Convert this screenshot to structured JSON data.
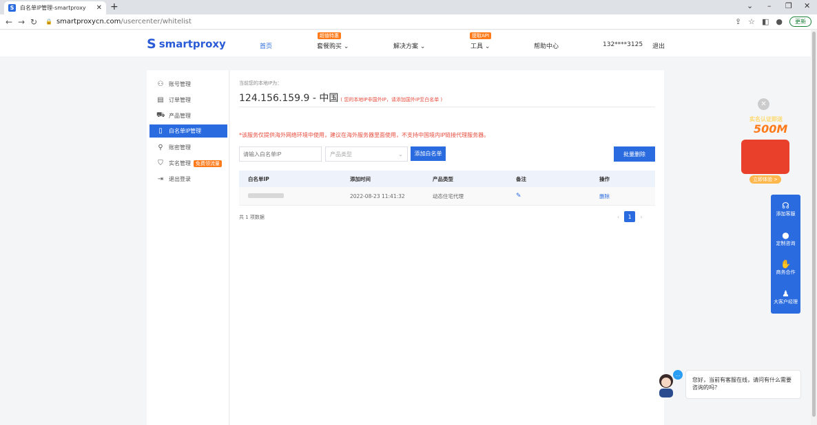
{
  "browser": {
    "tab_title": "白名单IP管理-smartproxy",
    "favicon_letter": "S",
    "url_host": "smartproxycn.com",
    "url_path": "/usercenter/whitelist",
    "update_label": "更新"
  },
  "header": {
    "logo_text": "smartproxy",
    "nav": [
      {
        "label": "首页",
        "badge": ""
      },
      {
        "label": "套餐购买 ⌄",
        "badge": "超值特惠"
      },
      {
        "label": "解决方案 ⌄",
        "badge": ""
      },
      {
        "label": "工具 ⌄",
        "badge": "提取API"
      },
      {
        "label": "帮助中心",
        "badge": ""
      }
    ],
    "user": "132****3125",
    "logout": "退出"
  },
  "sidebar": {
    "items": [
      {
        "label": "账号管理",
        "icon": "user-icon"
      },
      {
        "label": "订单管理",
        "icon": "order-icon"
      },
      {
        "label": "产品管理",
        "icon": "cart-icon"
      },
      {
        "label": "白名单IP管理",
        "icon": "document-icon"
      },
      {
        "label": "账密管理",
        "icon": "user-key-icon"
      },
      {
        "label": "实名管理",
        "icon": "shield-icon",
        "badge": "免费领流量"
      },
      {
        "label": "退出登录",
        "icon": "logout-icon"
      }
    ]
  },
  "main": {
    "ip_label": "当前您的本地IP为：",
    "ip_value": "124.156.159.9 - 中国",
    "ip_note": "( 您的本地IP非国外IP，请添加国外IP至白名单 )",
    "warning": "*该服务仅提供海外网络环境中使用，建议在海外服务器里面使用，不支持中国境内IP链接代理服务器。",
    "ip_input_placeholder": "请输入白名单IP",
    "type_select_placeholder": "产品类型",
    "add_button": "添加白名单",
    "batch_delete_button": "批量删除",
    "columns": [
      "白名单IP",
      "添加时间",
      "产品类型",
      "备注",
      "操作"
    ],
    "rows": [
      {
        "added": "2022-08-23 11:41:32",
        "type": "动态住宅代理",
        "action": "删除"
      }
    ],
    "total": "共 1 项数据",
    "current_page": "1"
  },
  "promo": {
    "title": "实名认证即送",
    "amount": "500M",
    "button": "立即体验 >"
  },
  "float_bar": {
    "items": [
      {
        "label": "添加客服",
        "icon": "headset-icon"
      },
      {
        "label": "定制咨询",
        "icon": "chat-icon"
      },
      {
        "label": "商务合作",
        "icon": "handshake-icon"
      },
      {
        "label": "大客户经理",
        "icon": "person-icon"
      }
    ]
  },
  "chat": {
    "message": "您好，当前有客服在线，请问有什么需要咨询的吗？"
  },
  "colors": {
    "accent": "#2a6be0",
    "warning": "#e84c3d",
    "badge": "#ff7a1a"
  }
}
